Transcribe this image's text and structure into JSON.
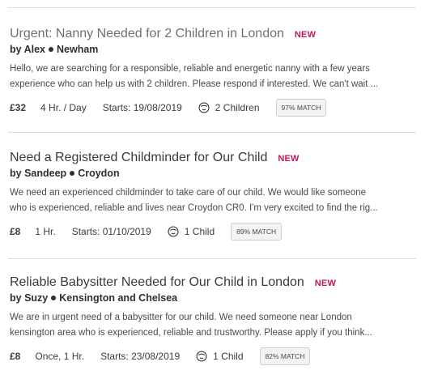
{
  "jobs": [
    {
      "title": "Urgent: Nanny Needed for 2 Children in London",
      "new_label": "NEW",
      "by_label": "by",
      "author": "Alex",
      "location": "Newham",
      "description_line1": "Hello, we are searching for a responsible, reliable and energetic nanny with a few years",
      "description_line2": "experience who can help us with 2 children. Please respond if interested. We can't wait ...",
      "price": "£32",
      "hours": "4 Hr. / Day",
      "starts": "Starts: 19/08/2019",
      "children": "2 Children",
      "match": "97% MATCH",
      "icon": "child-icon"
    },
    {
      "title": "Need a Registered Childminder for Our Child",
      "new_label": "NEW",
      "by_label": "by",
      "author": "Sandeep",
      "location": "Croydon",
      "description_line1": "We need an experienced childminder to take care of our child. We would like someone",
      "description_line2": "who is experienced, reliable and lives near Croydon CR0. I'm very excited to find the rig...",
      "price": "£8",
      "hours": "1 Hr.",
      "starts": "Starts: 01/10/2019",
      "children": "1 Child",
      "match": "89% MATCH",
      "icon": "child-icon"
    },
    {
      "title": "Reliable Babysitter Needed for Our Child in London",
      "new_label": "NEW",
      "by_label": "by",
      "author": "Suzy",
      "location": "Kensington and Chelsea",
      "description_line1": "We are in urgent need of a babysitter for our child. We need someone near London",
      "description_line2": "kensington area who is experienced, reliable and trustworthy. Please apply if you think...",
      "price": "£8",
      "hours": "Once, 1 Hr.",
      "starts": "Starts: 23/08/2019",
      "children": "1 Child",
      "match": "82% MATCH",
      "icon": "child-icon"
    }
  ],
  "colors": {
    "new_badge": "#c4165b",
    "title_urgent": "#707070",
    "title": "#3b3b3b",
    "divider": "#dcdcdc"
  }
}
